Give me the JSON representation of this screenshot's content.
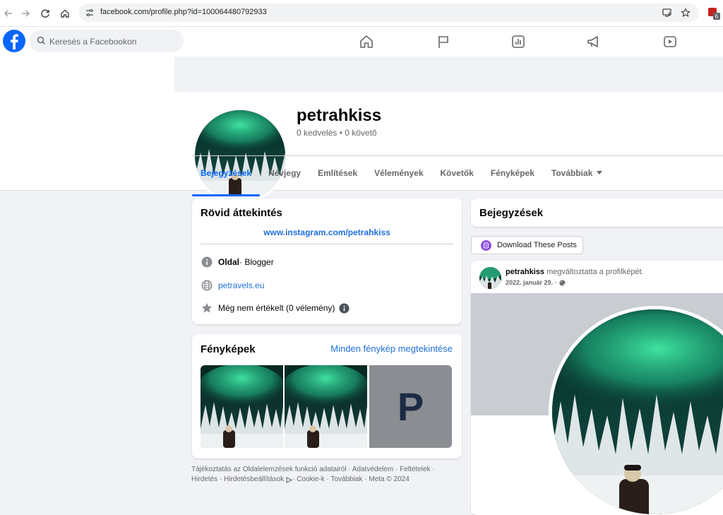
{
  "browser": {
    "url": "facebook.com/profile.php?id=100064480792933"
  },
  "header": {
    "search_placeholder": "Keresés a Facebookon"
  },
  "profile": {
    "name": "petrahkiss",
    "stats": "0 kedvelés • 0 követő"
  },
  "tabs": [
    {
      "label": "Bejegyzések",
      "active": true
    },
    {
      "label": "Névjegy"
    },
    {
      "label": "Említések"
    },
    {
      "label": "Vélemények"
    },
    {
      "label": "Követők"
    },
    {
      "label": "Fényképek"
    },
    {
      "label": "Továbbiak"
    }
  ],
  "intro": {
    "title": "Rövid áttekintés",
    "bio_link": "www.instagram.com/petrahkiss",
    "page_label": "Oldal",
    "page_category": " · Blogger",
    "website": "petravels.eu",
    "rating": "Még nem értékelt (0 vélemény)"
  },
  "photos": {
    "title": "Fényképek",
    "see_all": "Minden fénykép megtekintése",
    "placeholder_letter": "P"
  },
  "footer": {
    "line1": "Tájékoztatás az Oldalelemzések funkció adatairól · Adatvédelem · Feltételek ·",
    "line2_a": "Hirdetés · Hirdetésbeállítások",
    "line2_b": " · Cookie-k · Továbbiak · Meta © 2024"
  },
  "posts": {
    "title": "Bejegyzések",
    "download_label": "Download These Posts",
    "post": {
      "author": "petrahkiss",
      "action": " megváltoztatta a profilképét.",
      "date": "2022. január 29. ·"
    }
  },
  "colors": {
    "accent": "#0866ff",
    "link": "#216fdb",
    "aurora": "#1fa57a",
    "sky": "#0b2a2a"
  }
}
